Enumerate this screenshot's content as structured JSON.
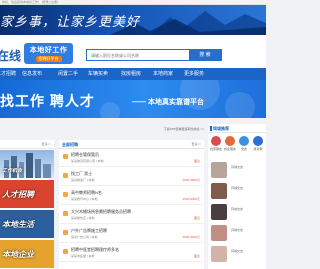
{
  "topbar": {
    "text": "你好，欢迎来到本地好工作！ [登录] [注册]"
  },
  "banner": {
    "slogan": "家乡事，让家乡更美好"
  },
  "header": {
    "logo_text": "在线",
    "badge_line1": "本地好工作",
    "badge_line2": "招聘好平台"
  },
  "search": {
    "placeholder": "请输入职位名称或公司名称",
    "button": "搜 索"
  },
  "nav": {
    "items": [
      "人才招聘",
      "信息发布",
      "闲置二手",
      "车辆买卖",
      "找房租房",
      "本地商家",
      "更多服务"
    ]
  },
  "hero": {
    "title": "找工作 聘人才",
    "platform": "—— 本地真实靠谱平台"
  },
  "left_panel": {
    "more": "更多>>",
    "thumbs": [
      "工作机会",
      "人才招聘",
      "本地生活",
      "本地企业"
    ]
  },
  "mid_bar": {
    "text": "下载APP查看更多职位信息 >>"
  },
  "mid_panel": {
    "tab": "全部招聘",
    "more": "更多>>",
    "jobs": [
      {
        "title": "招聘仓管保管员",
        "company": "某某物流有限公司 | 本地",
        "salary": "面议"
      },
      {
        "title": "找工厂 男士",
        "company": "某某制造厂 | 本地",
        "salary": "2500-3500元"
      },
      {
        "title": "高中教师招聘N名",
        "company": "某某教育中心 | 本地",
        "salary": "3500-6000元"
      },
      {
        "title": "大兴木桶场所急需招聘服务员招聘",
        "company": "某某餐饮店 | 本地",
        "salary": "面议"
      },
      {
        "title": "户外广告牌施工招聘",
        "company": "某某广告公司 | 本地",
        "salary": "3000-5000元"
      },
      {
        "title": "招聘中医堂招聘理疗师多名",
        "company": "某某中医堂 | 本地",
        "salary": "面议"
      }
    ]
  },
  "right_panel": {
    "title": "同城推荐",
    "categories": [
      {
        "label": "找男朋友",
        "color": "#d94b55"
      },
      {
        "label": "找女朋友",
        "color": "#e06a3a"
      },
      {
        "label": "交友",
        "color": "#3d8fe0"
      },
      {
        "label": "找对象",
        "color": "#2f6fd1"
      }
    ],
    "people": [
      {
        "name": "同城交友",
        "color": "#b7a59c"
      },
      {
        "name": "同城交友",
        "color": "#7f5a4d"
      },
      {
        "name": "同城交友",
        "color": "#4a3f3c"
      },
      {
        "name": "同城交友",
        "color": "#c18f84"
      },
      {
        "name": "同城交友",
        "color": "#d3b2a8"
      }
    ]
  }
}
